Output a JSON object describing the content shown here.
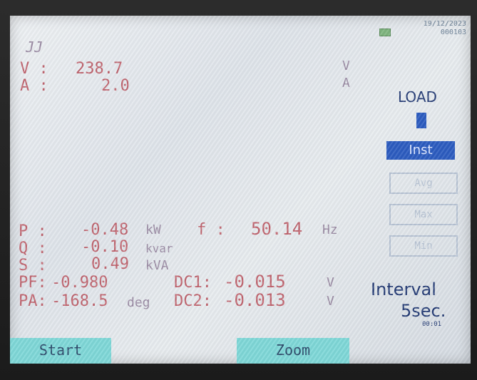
{
  "header": {
    "logo": "JJ",
    "datetime": "19/12/2023",
    "code": "000103"
  },
  "upper": {
    "v_label": "V :",
    "v_value": "238.7",
    "v_unit": "V",
    "a_label": "A :",
    "a_value": "2.0",
    "a_unit": "A"
  },
  "sidepanel": {
    "load": "LOAD",
    "inst": "Inst",
    "box1": "Avg",
    "box2": "Max",
    "box3": "Min",
    "interval_label": "Interval",
    "interval_value": "5sec.",
    "counter": "00:01"
  },
  "measurements": {
    "p_label": "P :",
    "p_value": "-0.48",
    "p_unit": "kW",
    "f_label": "f :",
    "f_value": "50.14",
    "f_unit": "Hz",
    "q_label": "Q :",
    "q_value": "-0.10",
    "q_unit": "kvar",
    "s_label": "S :",
    "s_value": "0.49",
    "s_unit": "kVA",
    "pf_label": "PF:",
    "pf_value": "-0.980",
    "dc1_label": "DC1:",
    "dc1_value": "-0.015",
    "dc1_unit": "V",
    "pa_label": "PA:",
    "pa_value": "-168.5",
    "pa_unit": "deg",
    "dc2_label": "DC2:",
    "dc2_value": "-0.013",
    "dc2_unit": "V"
  },
  "softkeys": {
    "start": "Start",
    "zoom": "Zoom"
  },
  "colors": {
    "value_pink": "#c0646e",
    "accent_navy": "#233a74",
    "highlight_blue": "#2c5cc0",
    "softkey_cyan": "#7fd8d8"
  }
}
